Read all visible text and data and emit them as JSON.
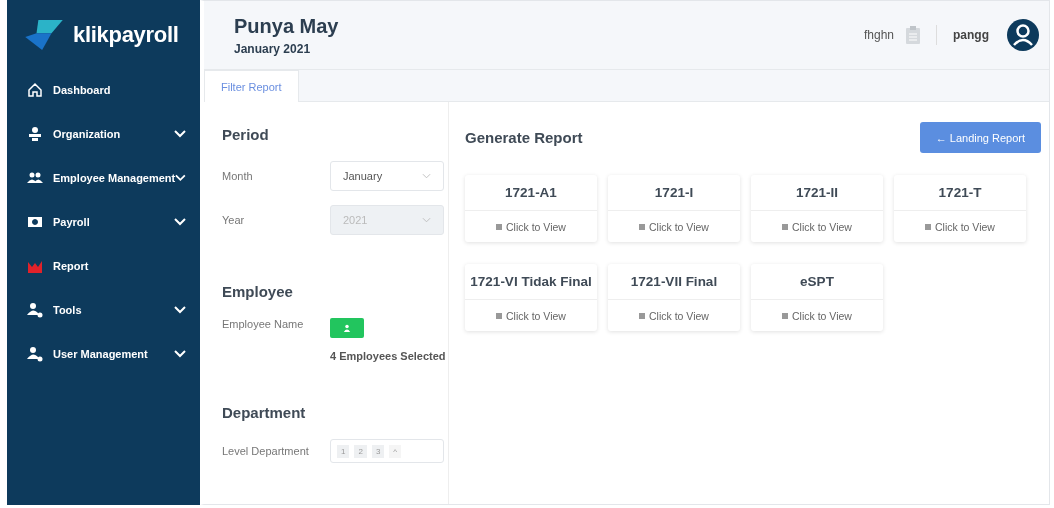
{
  "brand": {
    "name": "klikpayroll"
  },
  "sidebar": {
    "items": [
      {
        "label": "Dashboard",
        "kind": "home",
        "expandable": false,
        "selected": false
      },
      {
        "label": "Organization",
        "kind": "org",
        "expandable": true,
        "selected": false
      },
      {
        "label": "Employee Management",
        "kind": "people",
        "expandable": true,
        "selected": false
      },
      {
        "label": "Payroll",
        "kind": "money",
        "expandable": true,
        "selected": false
      },
      {
        "label": "Report",
        "kind": "chart",
        "expandable": false,
        "selected": true
      },
      {
        "label": "Tools",
        "kind": "usergear",
        "expandable": true,
        "selected": false
      },
      {
        "label": "User Management",
        "kind": "usergear",
        "expandable": true,
        "selected": false
      }
    ]
  },
  "header": {
    "title": "Punya May",
    "subtitle": "January 2021",
    "company": "fhghn",
    "user": "pangg"
  },
  "tabs": [
    {
      "label": "Filter Report",
      "selected": true
    }
  ],
  "period": {
    "title": "Period",
    "fields": [
      {
        "label": "Month",
        "value": "January",
        "disabled": false
      },
      {
        "label": "Year",
        "value": "2021",
        "disabled": true
      }
    ]
  },
  "employee": {
    "title": "Employee",
    "label": "Employee Name",
    "selected_text": "4 Employees Selected"
  },
  "department": {
    "title": "Department",
    "label": "Level Department",
    "levels": [
      "1",
      "2",
      "3"
    ],
    "toggle": "^"
  },
  "report": {
    "title": "Generate Report",
    "back_button": "← Landing Report",
    "cards": [
      {
        "title": "1721-A1",
        "action": "Click to View"
      },
      {
        "title": "1721-I",
        "action": "Click to View"
      },
      {
        "title": "1721-II",
        "action": "Click to View"
      },
      {
        "title": "1721-T",
        "action": "Click to View"
      },
      {
        "title": "1721-VI Tidak Final",
        "action": "Click to View"
      },
      {
        "title": "1721-VII Final",
        "action": "Click to View"
      },
      {
        "title": "eSPT",
        "action": "Click to View"
      }
    ]
  }
}
